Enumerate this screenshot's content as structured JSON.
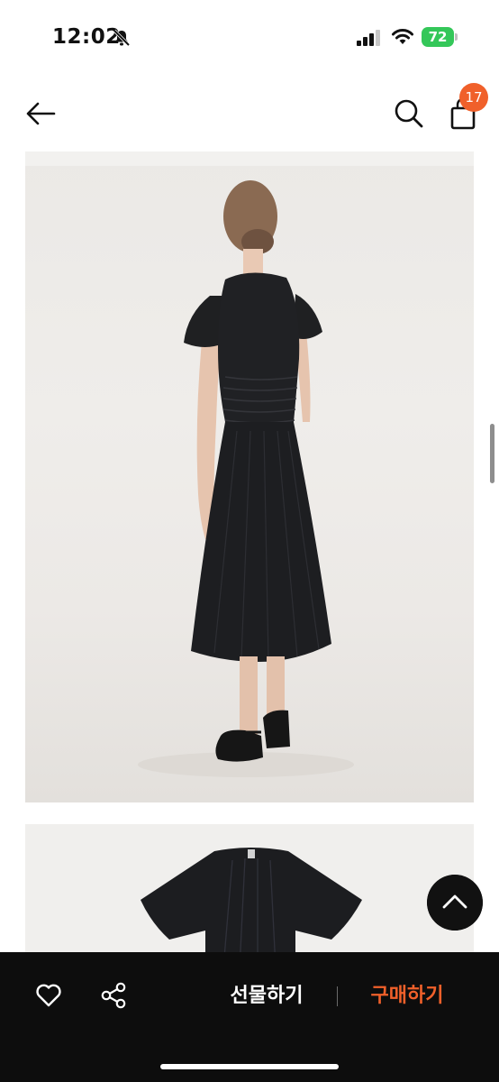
{
  "status_bar": {
    "time": "12:02",
    "battery": "72"
  },
  "nav": {
    "back_icon": "arrow-left-icon",
    "search_icon": "search-icon",
    "cart_icon": "shopping-bag-icon",
    "cart_count": "17"
  },
  "content": {
    "images": [
      "model-wearing-black-dress-back-view",
      "black-dress-product-shot"
    ]
  },
  "bottom_bar": {
    "like_icon": "heart-icon",
    "share_icon": "share-icon",
    "gift_label": "선물하기",
    "buy_label": "구매하기"
  },
  "colors": {
    "accent": "#f0602a",
    "bar_background": "#0d0d0d",
    "battery": "#34c759"
  }
}
